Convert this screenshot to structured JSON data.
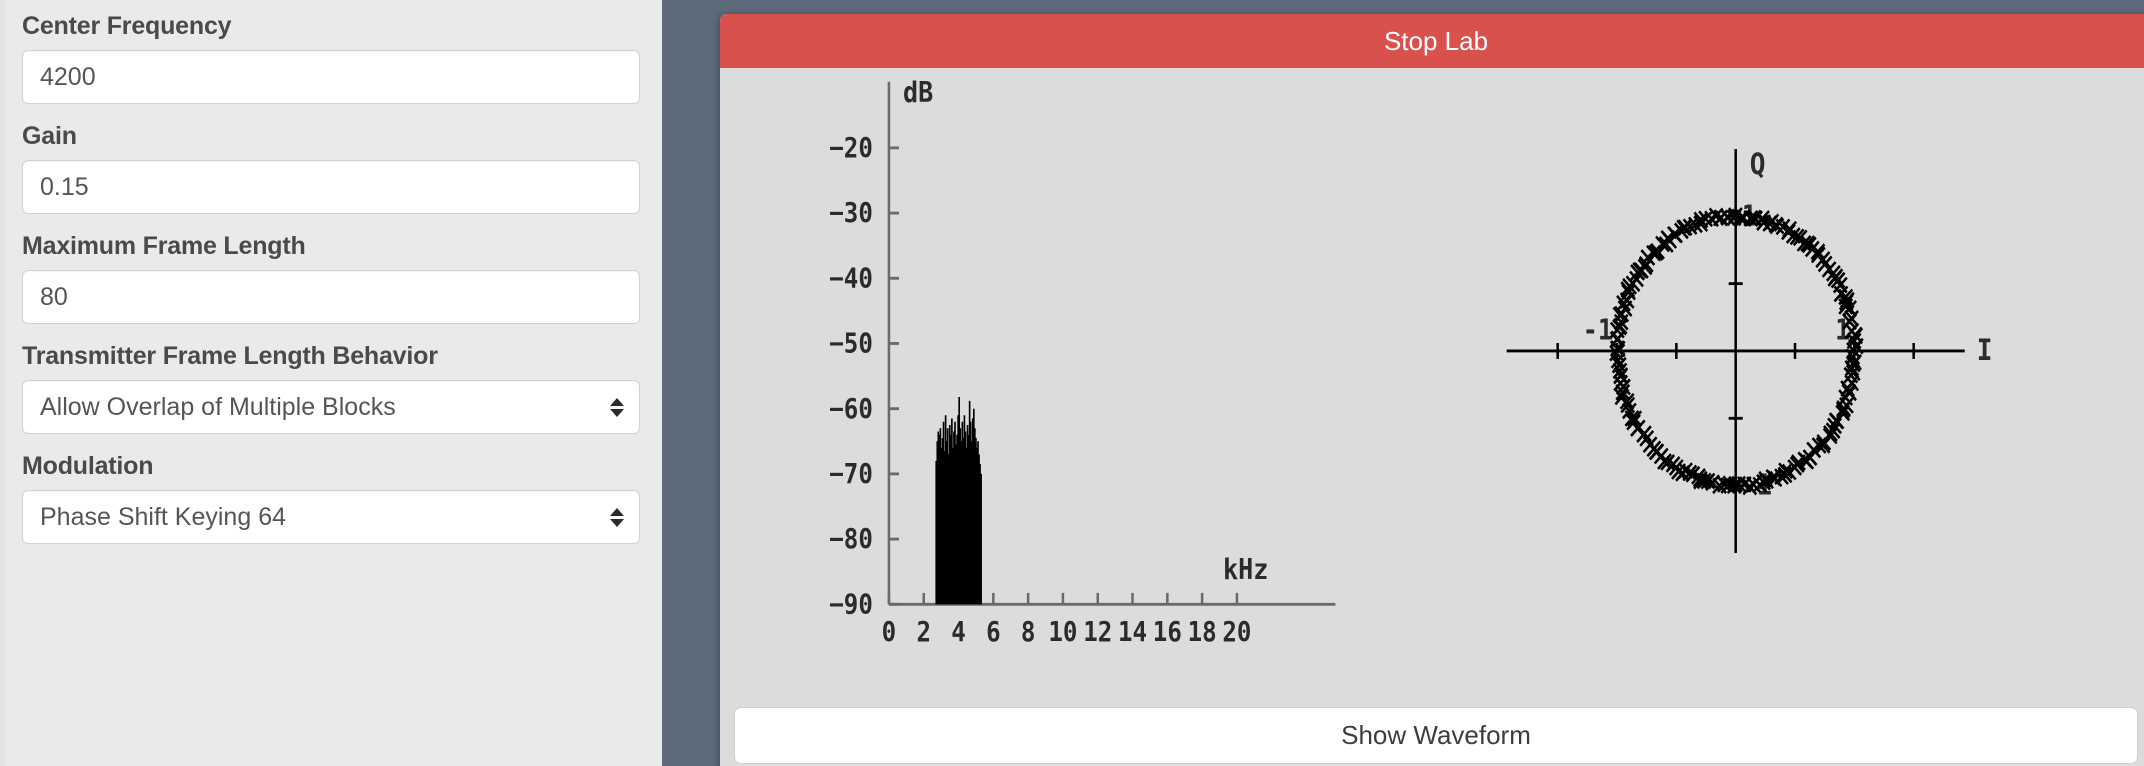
{
  "sidebar": {
    "fields": [
      {
        "label": "Center Frequency",
        "type": "text",
        "value": "4200",
        "placeholder": ""
      },
      {
        "label": "Gain",
        "type": "text",
        "value": "0.15",
        "placeholder": ""
      },
      {
        "label": "Maximum Frame Length",
        "type": "text",
        "value": "80",
        "placeholder": ""
      },
      {
        "label": "Transmitter Frame Length Behavior",
        "type": "select",
        "value": "Allow Overlap of Multiple Blocks",
        "placeholder": ""
      },
      {
        "label": "Modulation",
        "type": "select",
        "value": "Phase Shift Keying 64",
        "placeholder": ""
      }
    ]
  },
  "panel": {
    "header_label": "Stop Lab",
    "header_color": "#d8514d",
    "background_color": "#dcdcdc",
    "gutter_color": "#5d6a7a",
    "show_waveform_label": "Show Waveform"
  },
  "chart_data": [
    {
      "type": "bar",
      "name": "spectrum",
      "title": "",
      "xlabel": "kHz",
      "ylabel": "dB",
      "xlim": [
        0,
        21.5
      ],
      "ylim": [
        -90,
        -13
      ],
      "grid": false,
      "legend": "none",
      "xticks": [
        0,
        2,
        4,
        6,
        8,
        10,
        12,
        14,
        16,
        18,
        20
      ],
      "xticklabels": [
        "0",
        "2",
        "4",
        "6",
        "8",
        "10",
        "12",
        "14",
        "16",
        "18",
        "20"
      ],
      "yticks": [
        -20,
        -30,
        -40,
        -50,
        -60,
        -70,
        -80,
        -90
      ],
      "yticklabels": [
        "−20",
        "−30",
        "−40",
        "−50",
        "−60",
        "−70",
        "−80",
        "−90"
      ],
      "x": [
        2.7,
        2.76,
        2.82,
        2.88,
        2.94,
        3.0,
        3.06,
        3.12,
        3.18,
        3.24,
        3.3,
        3.36,
        3.42,
        3.48,
        3.54,
        3.6,
        3.66,
        3.72,
        3.78,
        3.84,
        3.9,
        3.96,
        4.02,
        4.08,
        4.14,
        4.2,
        4.26,
        4.32,
        4.38,
        4.44,
        4.5,
        4.56,
        4.62,
        4.68,
        4.74,
        4.8,
        4.86,
        4.92,
        4.98,
        5.04,
        5.1,
        5.16,
        5.22,
        5.28
      ],
      "values": [
        -68.0,
        -65.0,
        -63.5,
        -64.0,
        -63.0,
        -66.0,
        -64.5,
        -62.0,
        -66.5,
        -61.0,
        -65.0,
        -63.0,
        -67.0,
        -62.5,
        -64.0,
        -61.5,
        -66.0,
        -63.5,
        -62.0,
        -65.5,
        -64.0,
        -61.0,
        -58.2,
        -63.0,
        -65.0,
        -62.0,
        -64.5,
        -61.0,
        -63.5,
        -66.0,
        -62.5,
        -64.0,
        -58.8,
        -62.0,
        -65.0,
        -61.5,
        -60.0,
        -63.0,
        -64.5,
        -66.0,
        -65.0,
        -67.0,
        -68.5,
        -70.0
      ],
      "floor": -90,
      "noise_floor_db": -89.5,
      "peak_db": -58.2,
      "band_start_khz": 2.7,
      "band_end_khz": 5.3
    },
    {
      "type": "scatter",
      "name": "constellation",
      "title": "",
      "xlabel": "I",
      "ylabel": "Q",
      "xlim": [
        -2.0,
        2.0
      ],
      "ylim": [
        -1.55,
        1.55
      ],
      "grid": false,
      "legend": "none",
      "marker": "x",
      "xticks": [
        -1.5,
        -1.0,
        -0.5,
        0.5,
        1.0,
        1.5
      ],
      "yticks": [
        -1.0,
        -0.5,
        0.5,
        1.0
      ],
      "axis_value_labels": [
        {
          "text": "-1",
          "x": -1.0,
          "y": 0.0,
          "axis": "i"
        },
        {
          "text": "1",
          "x": 1.0,
          "y": 0.0,
          "axis": "i"
        },
        {
          "text": "1",
          "x": 0.0,
          "y": 1.0,
          "axis": "q"
        },
        {
          "text": "-1",
          "x": 0.0,
          "y": -1.0,
          "axis": "q"
        }
      ],
      "modulation_order": 64,
      "radius": 1.0,
      "num_points": 190,
      "description": "PSK-64 constellation: points distributed around the unit circle"
    }
  ]
}
